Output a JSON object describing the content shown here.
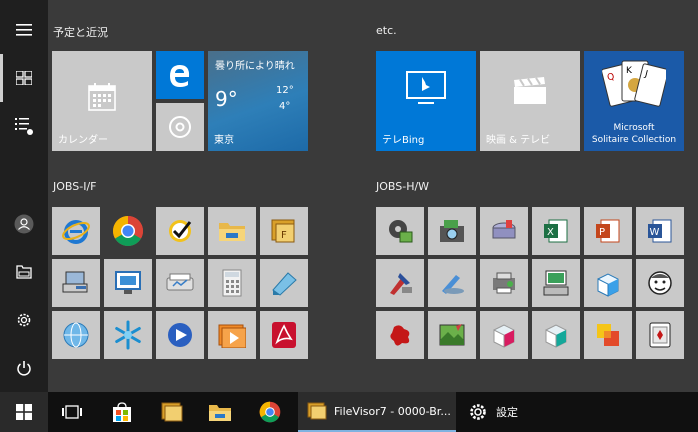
{
  "groups": [
    {
      "title": "予定と近況"
    },
    {
      "title": "etc."
    },
    {
      "title": "JOBS-I/F"
    },
    {
      "title": "JOBS-H/W"
    }
  ],
  "tiles": {
    "calendar": "カレンダー",
    "weather": {
      "condition": "曇り所により晴れ",
      "temp": "9°",
      "high": "12°",
      "low": "4°",
      "city": "東京"
    },
    "bing": "テレBing",
    "movies": "映画 & テレビ",
    "solitaire_line1": "Microsoft",
    "solitaire_line2": "Solitaire Collection"
  },
  "taskbar": {
    "filevisor": "FileVisor7 - 0000-Br...",
    "settings": "設定"
  },
  "colors": {
    "accent": "#0078d7",
    "rail": "#1f1f1f",
    "panel": "#3a3a3a",
    "taskbar": "#101010"
  }
}
